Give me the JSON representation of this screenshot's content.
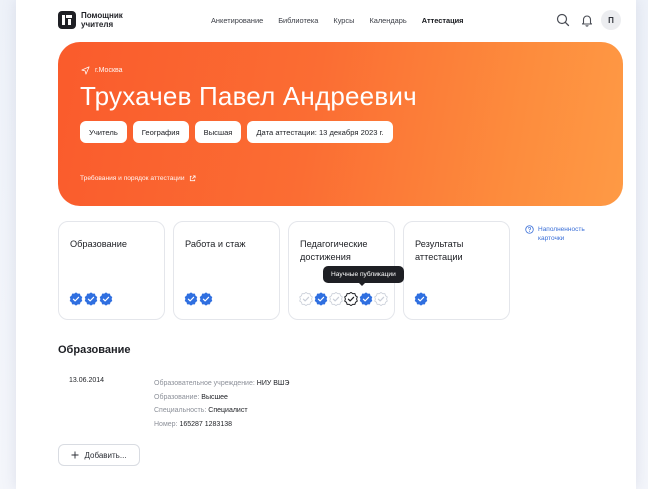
{
  "header": {
    "logo_line1": "Помощник",
    "logo_line2": "учителя",
    "nav": [
      {
        "label": "Анкетирование",
        "active": false
      },
      {
        "label": "Библиотека",
        "active": false
      },
      {
        "label": "Курсы",
        "active": false
      },
      {
        "label": "Календарь",
        "active": false
      },
      {
        "label": "Аттестация",
        "active": true
      }
    ],
    "icons": [
      "search-icon",
      "bell-icon"
    ],
    "avatar_letter": "П"
  },
  "hero": {
    "location": "г.Москва",
    "name": "Трухачев Павел Андреевич",
    "chips": [
      "Учитель",
      "География",
      "Высшая",
      "Дата аттестации: 13 декабря 2023 г."
    ],
    "link": "Требования и порядок аттестации",
    "gradient": [
      "#fa5b2c",
      "#fe9a45"
    ]
  },
  "cards": [
    {
      "title": "Образование",
      "badges": [
        "done",
        "done",
        "done"
      ]
    },
    {
      "title": "Работа и стаж",
      "badges": [
        "done",
        "done"
      ]
    },
    {
      "title": "Педагогические достижения",
      "badges": [
        "empty",
        "done",
        "empty",
        "hover",
        "done",
        "empty"
      ]
    },
    {
      "title": "Результаты аттестации",
      "badges": [
        "done"
      ]
    }
  ],
  "tooltip": "Научные публикации",
  "fill_link": "Наполненность карточки",
  "section": {
    "title": "Образование",
    "record": {
      "date": "13.06.2014",
      "lines": [
        {
          "label": "Образовательное учреждение:",
          "value": "НИУ ВШЭ"
        },
        {
          "label": "Образование:",
          "value": "Высшее"
        },
        {
          "label": "Специальность:",
          "value": "Специалист"
        },
        {
          "label": "Номер:",
          "value": "165287 1283138"
        }
      ]
    },
    "add_label": "Добавить..."
  },
  "colors": {
    "accent_blue": "#3a6fd8",
    "badge_blue": "#2f6fe0",
    "dark": "#1e1f24"
  }
}
